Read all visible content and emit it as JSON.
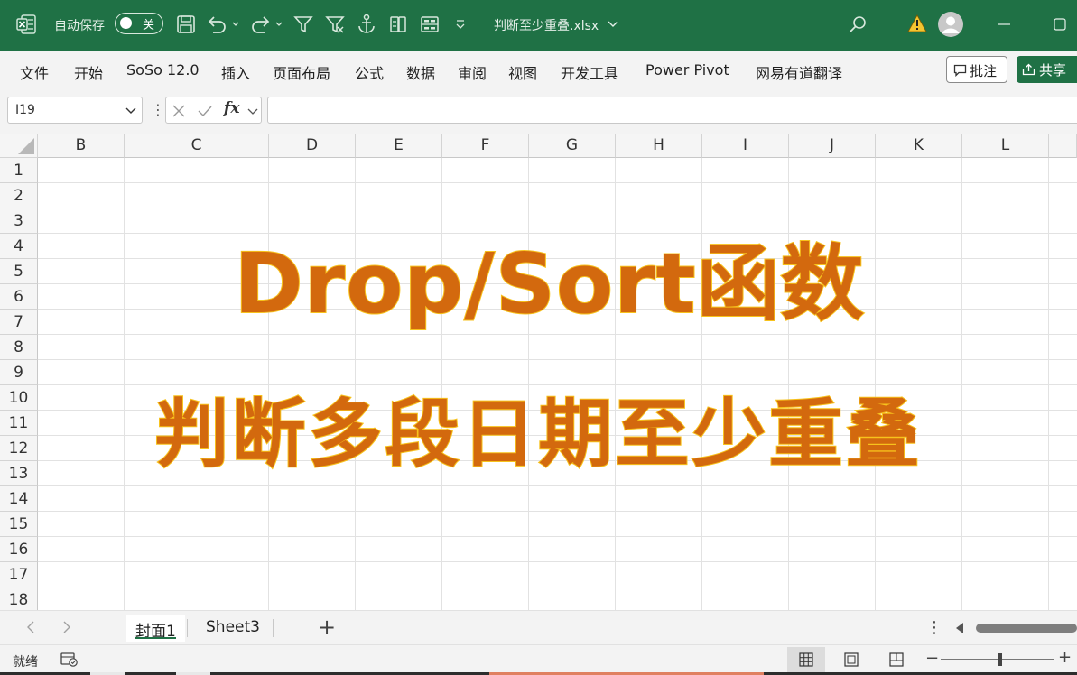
{
  "titlebar": {
    "autosave_label": "自动保存",
    "toggle_label": "关",
    "filename": "判断至少重叠.xlsx"
  },
  "ribbon": {
    "tabs": [
      "文件",
      "开始",
      "SoSo 12.0",
      "插入",
      "页面布局",
      "公式",
      "数据",
      "审阅",
      "视图",
      "开发工具",
      "Power Pivot",
      "网易有道翻译"
    ],
    "comment_label": "批注",
    "share_label": "共享"
  },
  "formula_bar": {
    "name_box": "I19",
    "fx_label": "fx",
    "formula": ""
  },
  "grid": {
    "columns": [
      "B",
      "C",
      "D",
      "E",
      "F",
      "G",
      "H",
      "I",
      "J",
      "K",
      "L"
    ],
    "rows": [
      "1",
      "2",
      "3",
      "4",
      "5",
      "6",
      "7",
      "8",
      "9",
      "10",
      "11",
      "12",
      "13",
      "14",
      "15",
      "16",
      "17",
      "18"
    ]
  },
  "content": {
    "title_line1": "Drop/Sort函数",
    "title_line2": "判断多段日期至少重叠",
    "text_color": "#d3690e",
    "outline_color": "#f7c21c"
  },
  "sheets": {
    "tabs": [
      "封面1",
      "Sheet3"
    ],
    "active_index": 0
  },
  "statusbar": {
    "status": "就绪"
  },
  "colors": {
    "titlebar_bg": "#1f7145",
    "ribbon_bg": "#f3f3f3"
  }
}
